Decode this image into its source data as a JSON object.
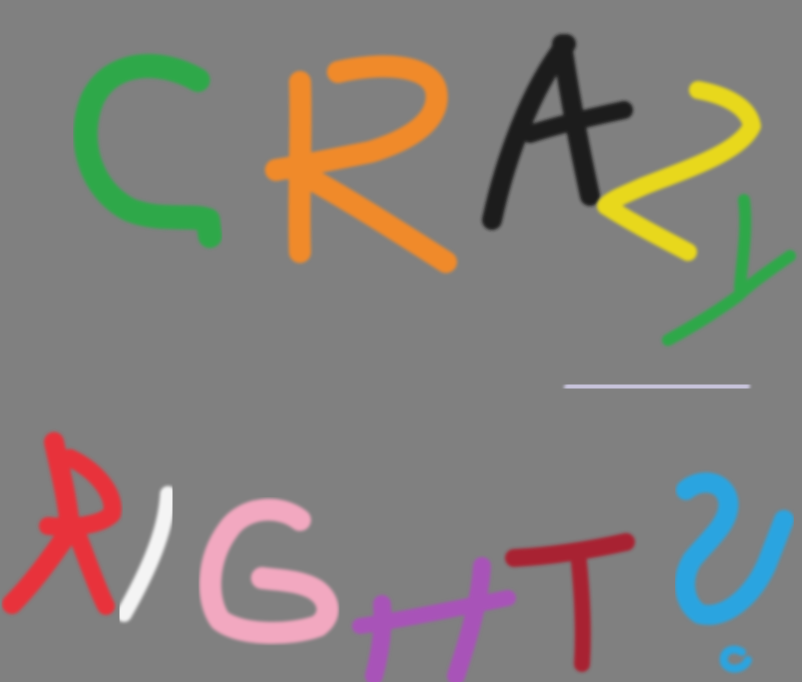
{
  "canvas": {
    "background_color": "#808080"
  },
  "words": [
    {
      "text": "CRAZY",
      "letters": [
        {
          "char": "C",
          "color": "#2fa84a"
        },
        {
          "char": "R",
          "color": "#f08a2a"
        },
        {
          "char": "A",
          "color": "#1a1a1a"
        },
        {
          "char": "Z",
          "color": "#e8d81c"
        },
        {
          "char": "Y",
          "color": "#2fa84a"
        }
      ]
    },
    {
      "text": "RIGHT?",
      "letters": [
        {
          "char": "R",
          "color": "#e8303a"
        },
        {
          "char": "I",
          "color": "#f4f4f4"
        },
        {
          "char": "G",
          "color": "#f2a8c0"
        },
        {
          "char": "H",
          "color": "#a852b8"
        },
        {
          "char": "T",
          "color": "#a82232"
        },
        {
          "char": "?",
          "color": "#2aa4e0"
        }
      ]
    }
  ],
  "divider": {
    "color": "#c8c4dc"
  }
}
